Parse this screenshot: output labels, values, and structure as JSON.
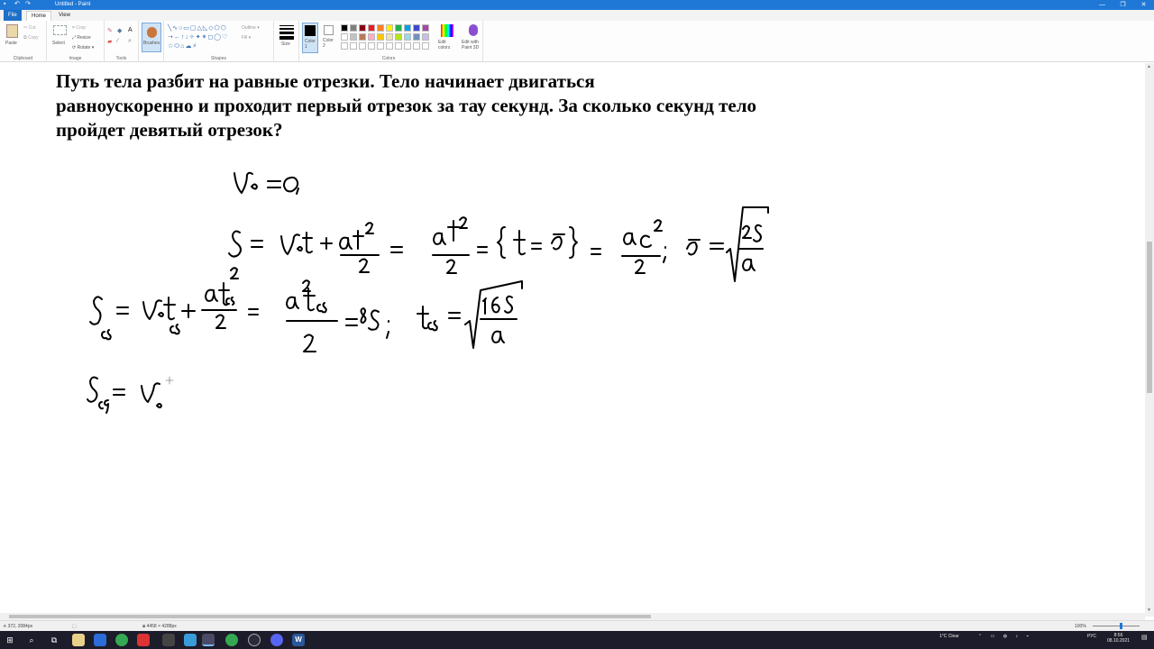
{
  "window": {
    "title": "Untitled - Paint",
    "controls": [
      "—",
      "❐",
      "✕"
    ]
  },
  "tabs": {
    "file": "File",
    "home": "Home",
    "view": "View"
  },
  "ribbon": {
    "clipboard": {
      "paste": "Paste",
      "cut": "Cut",
      "copy": "Copy",
      "label": "Clipboard"
    },
    "image": {
      "select": "Select",
      "crop": "Crop",
      "resize": "Resize",
      "rotate": "Rotate ▾",
      "label": "Image"
    },
    "tools": {
      "label": "Tools"
    },
    "brushes": {
      "label": "Brushes"
    },
    "shapes": {
      "outline": "Outline ▾",
      "fill": "Fill ▾",
      "label": "Shapes"
    },
    "size": {
      "label": "Size"
    },
    "color1": {
      "label": "Color 1"
    },
    "color2": {
      "label": "Color 2"
    },
    "colors": {
      "label": "Colors",
      "palette_row1": [
        "#000000",
        "#7f7f7f",
        "#880015",
        "#ed1c24",
        "#ff7f27",
        "#fff200",
        "#22b14c",
        "#00a2e8",
        "#3f48cc",
        "#a349a4"
      ],
      "palette_row2": [
        "#ffffff",
        "#c3c3c3",
        "#b97a57",
        "#ffaec9",
        "#ffc90e",
        "#efe4b0",
        "#b5e61d",
        "#99d9ea",
        "#7092be",
        "#c8bfe7"
      ]
    },
    "edit_colors": "Edit colors",
    "edit_paint3d": "Edit with Paint 3D"
  },
  "canvas": {
    "problem_lines": [
      "Путь тела разбит на равные отрезки. Тело начинает двигаться",
      "равноускоренно и проходит первый отрезок за тау секунд. За сколько секунд тело",
      "пройдет девятый отрезок?"
    ]
  },
  "status": {
    "cursor": "372, 2084px",
    "selection": "",
    "size": "4458 × 4288px",
    "zoom": "100%"
  },
  "taskbar": {
    "weather": "1°C Clear",
    "lang": "РУС",
    "time": "8:56",
    "date": "08.10.2021"
  }
}
